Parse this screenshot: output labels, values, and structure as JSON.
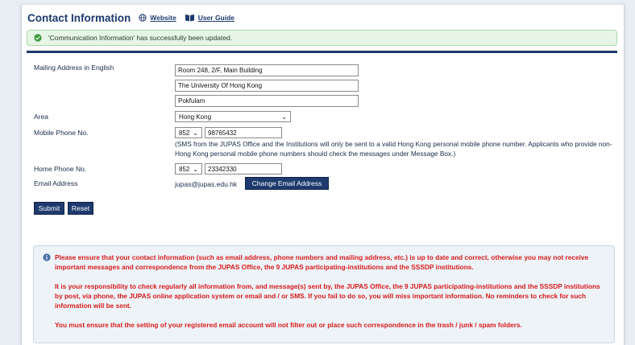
{
  "header": {
    "title": "Contact Information",
    "website_link": "Website",
    "user_guide_link": "User Guide"
  },
  "alert": {
    "message": "'Communication Information' has successfully been updated."
  },
  "form": {
    "mailing_label": "Mailing Address in English",
    "mailing_line1": "Room 248, 2/F, Main Building",
    "mailing_line2": "The University Of Hong Kong",
    "mailing_line3": "Pokfulam",
    "area_label": "Area",
    "area_value": "Hong Kong",
    "mobile_label": "Mobile Phone No.",
    "mobile_code": "852",
    "mobile_number": "98765432",
    "mobile_note": "(SMS from the JUPAS Office and the Institutions will only be sent to a valid Hong Kong personal mobile phone number. Applicants who provide non-Hong Kong personal mobile phone numbers should check the messages under Message Box.)",
    "home_label": "Home Phone No.",
    "home_code": "852",
    "home_number": "23342330",
    "email_label": "Email Address",
    "email_value": "jupas@jupas.edu.hk",
    "change_email_button": "Change Email Address"
  },
  "actions": {
    "submit": "Submit",
    "reset": "Reset"
  },
  "notice": {
    "p1": "Please ensure that your contact information (such as email address, phone numbers and mailing address, etc.) is up to date and correct, otherwise you may not receive important messages and correspondence from the JUPAS Office, the 9 JUPAS participating-institutions and the SSSDP institutions.",
    "p2": "It is your responsibility to check regularly all information from, and message(s) sent by, the JUPAS Office, the 9 JUPAS participating-institutions and the SSSDP institutions by post, via phone, the JUPAS online application system or email and / or SMS. If you fail to do so, you will miss important information. No reminders to check for such information will be sent.",
    "p3": "You must ensure that the setting of your registered email account will not filter out or place such correspondence in the trash / junk / spam folders."
  },
  "colors": {
    "primary": "#1e3a6e",
    "success_bg": "#e6f5e6",
    "warning_text": "#d81b1b"
  }
}
